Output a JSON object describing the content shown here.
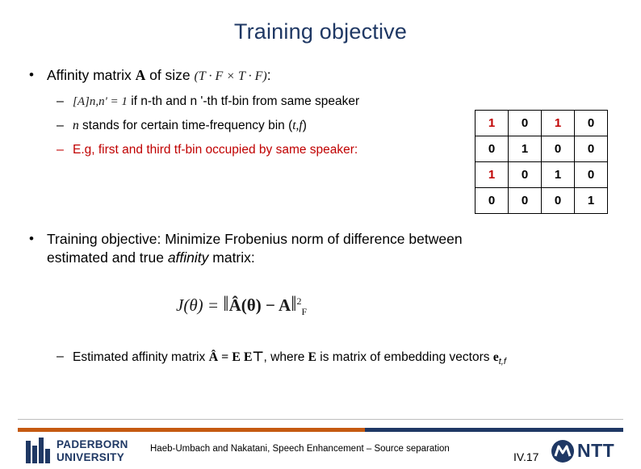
{
  "slide": {
    "title": "Training objective",
    "page_number": "IV.17",
    "footer": "Haeb-Umbach and Nakatani, Speech Enhancement – Source separation"
  },
  "bullets": [
    {
      "marker": "•",
      "text_before": "Affinity matrix ",
      "symbol_A": "A",
      "text_mid": " of size ",
      "formula": "(T · F × T · F)",
      "text_after": ":"
    },
    {
      "marker": "•",
      "line1": "Training objective: Minimize Frobenius norm of difference between",
      "line2_before": "estimated and true ",
      "line2_italic": "affinity",
      "line2_after": " matrix:"
    }
  ],
  "sub_bullets": [
    {
      "marker": "–",
      "formula": "[A]n,n' = 1",
      "text": " if n-th and n '-th tf-bin from same speaker",
      "color": "#000000"
    },
    {
      "marker": "–",
      "text_a": "n",
      "text_b": " stands for certain time-frequency bin (",
      "text_c": "t,f",
      "text_d": ")",
      "color": "#000000"
    },
    {
      "marker": "–",
      "text": "E.g, first and third tf-bin occupied by same speaker:",
      "color": "#C00000"
    },
    {
      "marker": "–",
      "text_a": "Estimated affinity matrix ",
      "formula": "Â = E E⊤",
      "text_b": ", where ",
      "symbol_E": "E",
      "text_c": " is matrix of embedding vectors ",
      "symbol_e": "e",
      "sub_e": "t,f"
    }
  ],
  "formula_main": {
    "lhs": "J(θ) = ",
    "norm_open": "‖",
    "inner": "Â(θ) − A",
    "norm_close": "‖",
    "sup": "2",
    "sub": "F"
  },
  "matrix": {
    "rows": [
      [
        {
          "v": "1",
          "c": "red"
        },
        {
          "v": "0",
          "c": "blk"
        },
        {
          "v": "1",
          "c": "red"
        },
        {
          "v": "0",
          "c": "blk"
        }
      ],
      [
        {
          "v": "0",
          "c": "blk"
        },
        {
          "v": "1",
          "c": "blk"
        },
        {
          "v": "0",
          "c": "blk"
        },
        {
          "v": "0",
          "c": "blk"
        }
      ],
      [
        {
          "v": "1",
          "c": "red"
        },
        {
          "v": "0",
          "c": "blk"
        },
        {
          "v": "1",
          "c": "blk"
        },
        {
          "v": "0",
          "c": "blk"
        }
      ],
      [
        {
          "v": "0",
          "c": "blk"
        },
        {
          "v": "0",
          "c": "blk"
        },
        {
          "v": "0",
          "c": "blk"
        },
        {
          "v": "1",
          "c": "blk"
        }
      ]
    ]
  },
  "logos": {
    "paderborn_line1": "PADERBORN",
    "paderborn_line2": "UNIVERSITY",
    "ntt": "NTT"
  },
  "colors": {
    "title": "#1F3864",
    "accent_red": "#C00000",
    "rule_orange": "#C55A11",
    "rule_blue": "#1F3864"
  }
}
